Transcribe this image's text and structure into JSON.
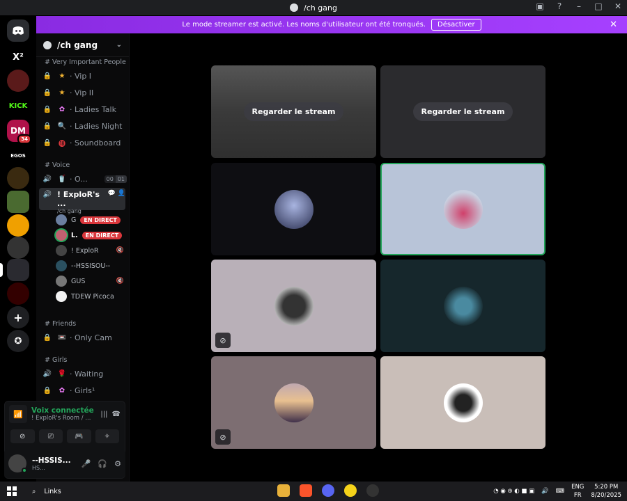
{
  "window": {
    "title": "/ch gang"
  },
  "banner": {
    "text": "Le mode streamer est activé. Les noms d'utilisateur ont été tronqués.",
    "button": "Désactiver"
  },
  "guild": {
    "name": "/ch gang"
  },
  "categories": {
    "vip": "# Very Important People",
    "voice": "# Voice",
    "friends": "# Friends",
    "girls": "# Girls"
  },
  "channels": {
    "vip1": {
      "emoji": "★",
      "name": "· Vip I"
    },
    "vip2": {
      "emoji": "★",
      "name": "· Vip II"
    },
    "ladies_talk": {
      "emoji": "✿",
      "name": "· Ladies Talk"
    },
    "ladies_night": {
      "emoji": "🔍",
      "name": "· Ladies Night"
    },
    "soundboard": {
      "emoji": "⓲",
      "name": "· Soundboard"
    },
    "o": {
      "emoji": "🥤",
      "name": "· O...",
      "count1": "00",
      "count2": "01"
    },
    "explor": {
      "name": "! ExploR's ...",
      "sub": "/ch gang"
    },
    "only_cam": {
      "emoji": "📼",
      "name": "· Only Cam"
    },
    "waiting": {
      "emoji": "🌹",
      "name": "· Waiting"
    },
    "girls1": {
      "emoji": "✿",
      "name": "· Girls¹"
    }
  },
  "voice_users": [
    {
      "name": "G",
      "live": "EN DIRECT"
    },
    {
      "name": "L.",
      "live": "EN DIRECT"
    },
    {
      "name": "! ExploR",
      "live": ""
    },
    {
      "name": "--HSSISOU--",
      "live": ""
    },
    {
      "name": "GUS",
      "live": ""
    },
    {
      "name": "TDEW Picoca",
      "live": ""
    }
  ],
  "voice_connection": {
    "title": "Voix connectée",
    "sub": "! ExploR's Room / ..."
  },
  "user": {
    "name": "--HSSIS...",
    "sub": "HS..."
  },
  "stream_tiles": {
    "button": "Regarder le stream"
  },
  "taskbar": {
    "search": "Links",
    "lang1": "ENG",
    "lang2": "FR",
    "time": "5:20 PM",
    "date": "8/20/2025"
  },
  "colors": {
    "banner": "#9b30ff",
    "live": "#da373c",
    "connected": "#23a55a",
    "speaking_border": "#23a55a"
  },
  "servers": [
    {
      "label": "X²",
      "badge": ""
    },
    {
      "label": "",
      "badge": ""
    },
    {
      "label": "KICK",
      "badge": ""
    },
    {
      "label": "DM",
      "badge": "34"
    },
    {
      "label": "EGOS",
      "badge": ""
    },
    {
      "label": "",
      "badge": ""
    },
    {
      "label": "",
      "badge": ""
    },
    {
      "label": "",
      "badge": ""
    },
    {
      "label": "",
      "badge": ""
    },
    {
      "label": "",
      "badge": ""
    },
    {
      "label": "",
      "badge": ""
    }
  ]
}
